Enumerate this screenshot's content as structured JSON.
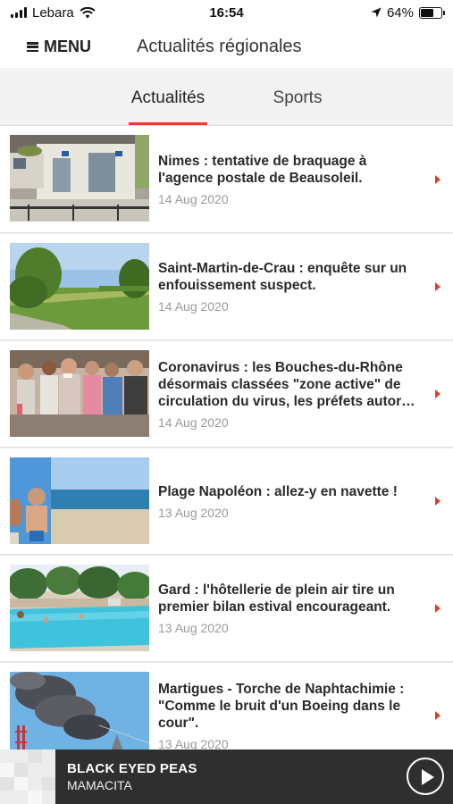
{
  "status_bar": {
    "carrier": "Lebara",
    "time": "16:54",
    "battery": "64%",
    "battery_level": 0.64
  },
  "header": {
    "menu_label": "MENU",
    "title": "Actualités régionales"
  },
  "tabs": [
    {
      "label": "Actualités",
      "active": true
    },
    {
      "label": "Sports",
      "active": false
    }
  ],
  "news": [
    {
      "title": "Nimes : tentative de braquage à l'agence postale de Beausoleil.",
      "date": "14 Aug 2020"
    },
    {
      "title": "Saint-Martin-de-Crau : enquête sur un enfouissement suspect.",
      "date": "14 Aug 2020"
    },
    {
      "title": "Coronavirus : les Bouches-du-Rhône désormais classées \"zone active\" de circulation du virus, les préfets autor…",
      "date": "14 Aug 2020"
    },
    {
      "title": "Plage Napoléon : allez-y en navette !",
      "date": "13 Aug 2020"
    },
    {
      "title": "Gard : l'hôtellerie de plein air tire un premier bilan estival encourageant.",
      "date": "13 Aug 2020"
    },
    {
      "title": "Martigues - Torche de Naphtachimie : \"Comme le bruit d'un Boeing dans le cour\".",
      "date": "13 Aug 2020"
    }
  ],
  "player": {
    "artist": "BLACK EYED PEAS",
    "song": "MAMACITA"
  },
  "colors": {
    "accent": "#d9412c",
    "player_bg": "#2f2f2f",
    "tab_bg": "#f2f2f2"
  }
}
